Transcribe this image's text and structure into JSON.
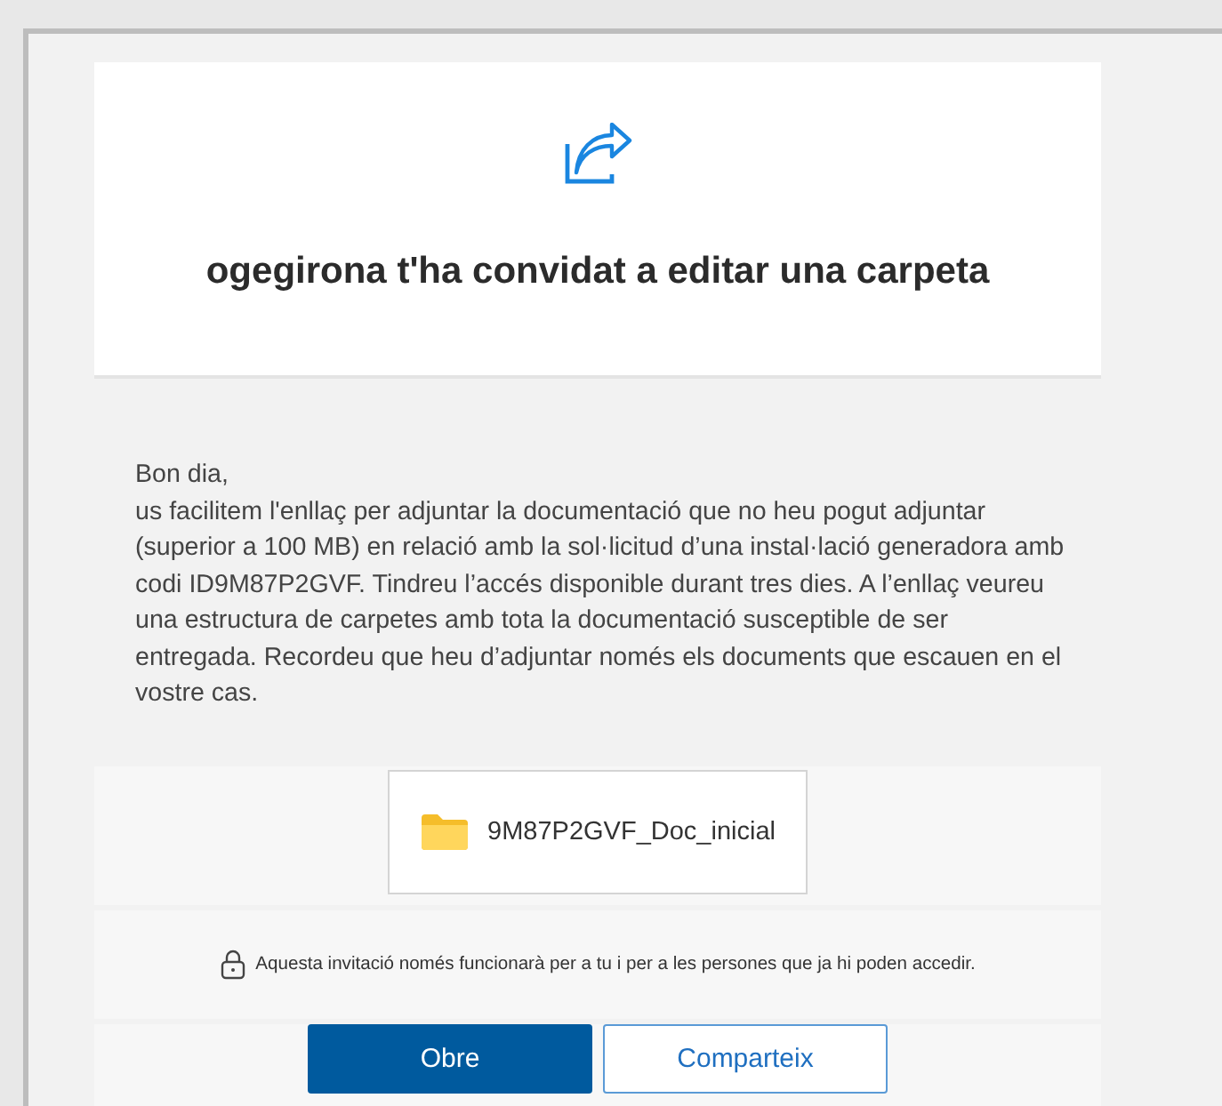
{
  "header": {
    "title": "ogegirona t'ha convidat a editar una carpeta"
  },
  "message": {
    "greeting": "Bon dia,",
    "body": "us facilitem l'enllaç per adjuntar la documentació que no heu pogut adjuntar (superior a 100 MB) en relació amb la sol·licitud d’una instal·lació generadora amb codi ID9M87P2GVF. Tindreu l’accés disponible durant tres dies. A l’enllaç veureu una estructura de carpetes amb tota la documentació susceptible de ser entregada. Recordeu que heu d’adjuntar només els documents que escauen en el vostre cas."
  },
  "folder": {
    "name": "9M87P2GVF_Doc_inicial"
  },
  "notice": "Aquesta invitació només funcionarà per a tu i per a les persones que ja hi poden accedir.",
  "buttons": [
    {
      "label": "Obre",
      "kind": "primary"
    },
    {
      "label": "Comparteix",
      "kind": "secondary"
    }
  ]
}
